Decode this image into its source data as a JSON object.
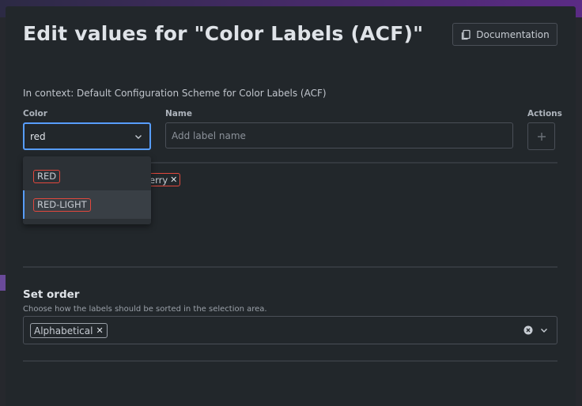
{
  "modal": {
    "title": "Edit values for \"Color Labels (ACF)\"",
    "documentation_label": "Documentation",
    "context_text": "In context: Default Configuration Scheme for Color Labels (ACF)"
  },
  "fields": {
    "color_label": "Color",
    "color_value": "red",
    "name_label": "Name",
    "name_placeholder": "Add label name",
    "actions_label": "Actions"
  },
  "dropdown": {
    "options": [
      {
        "label": "RED"
      },
      {
        "label": "RED-LIGHT"
      }
    ]
  },
  "existing_label_fragment": "erry",
  "order": {
    "title": "Set order",
    "description": "Choose how the labels should be sorted in the selection area.",
    "selected": "Alphabetical"
  },
  "icons": {
    "documentation": "copy-document-icon",
    "color_dropdown": "chevron-down-icon",
    "add": "plus-icon",
    "clear": "clear-circle-icon",
    "order_dropdown": "chevron-down-icon"
  },
  "colors": {
    "accent": "#579dff",
    "label_border_red": "#e2483d"
  }
}
